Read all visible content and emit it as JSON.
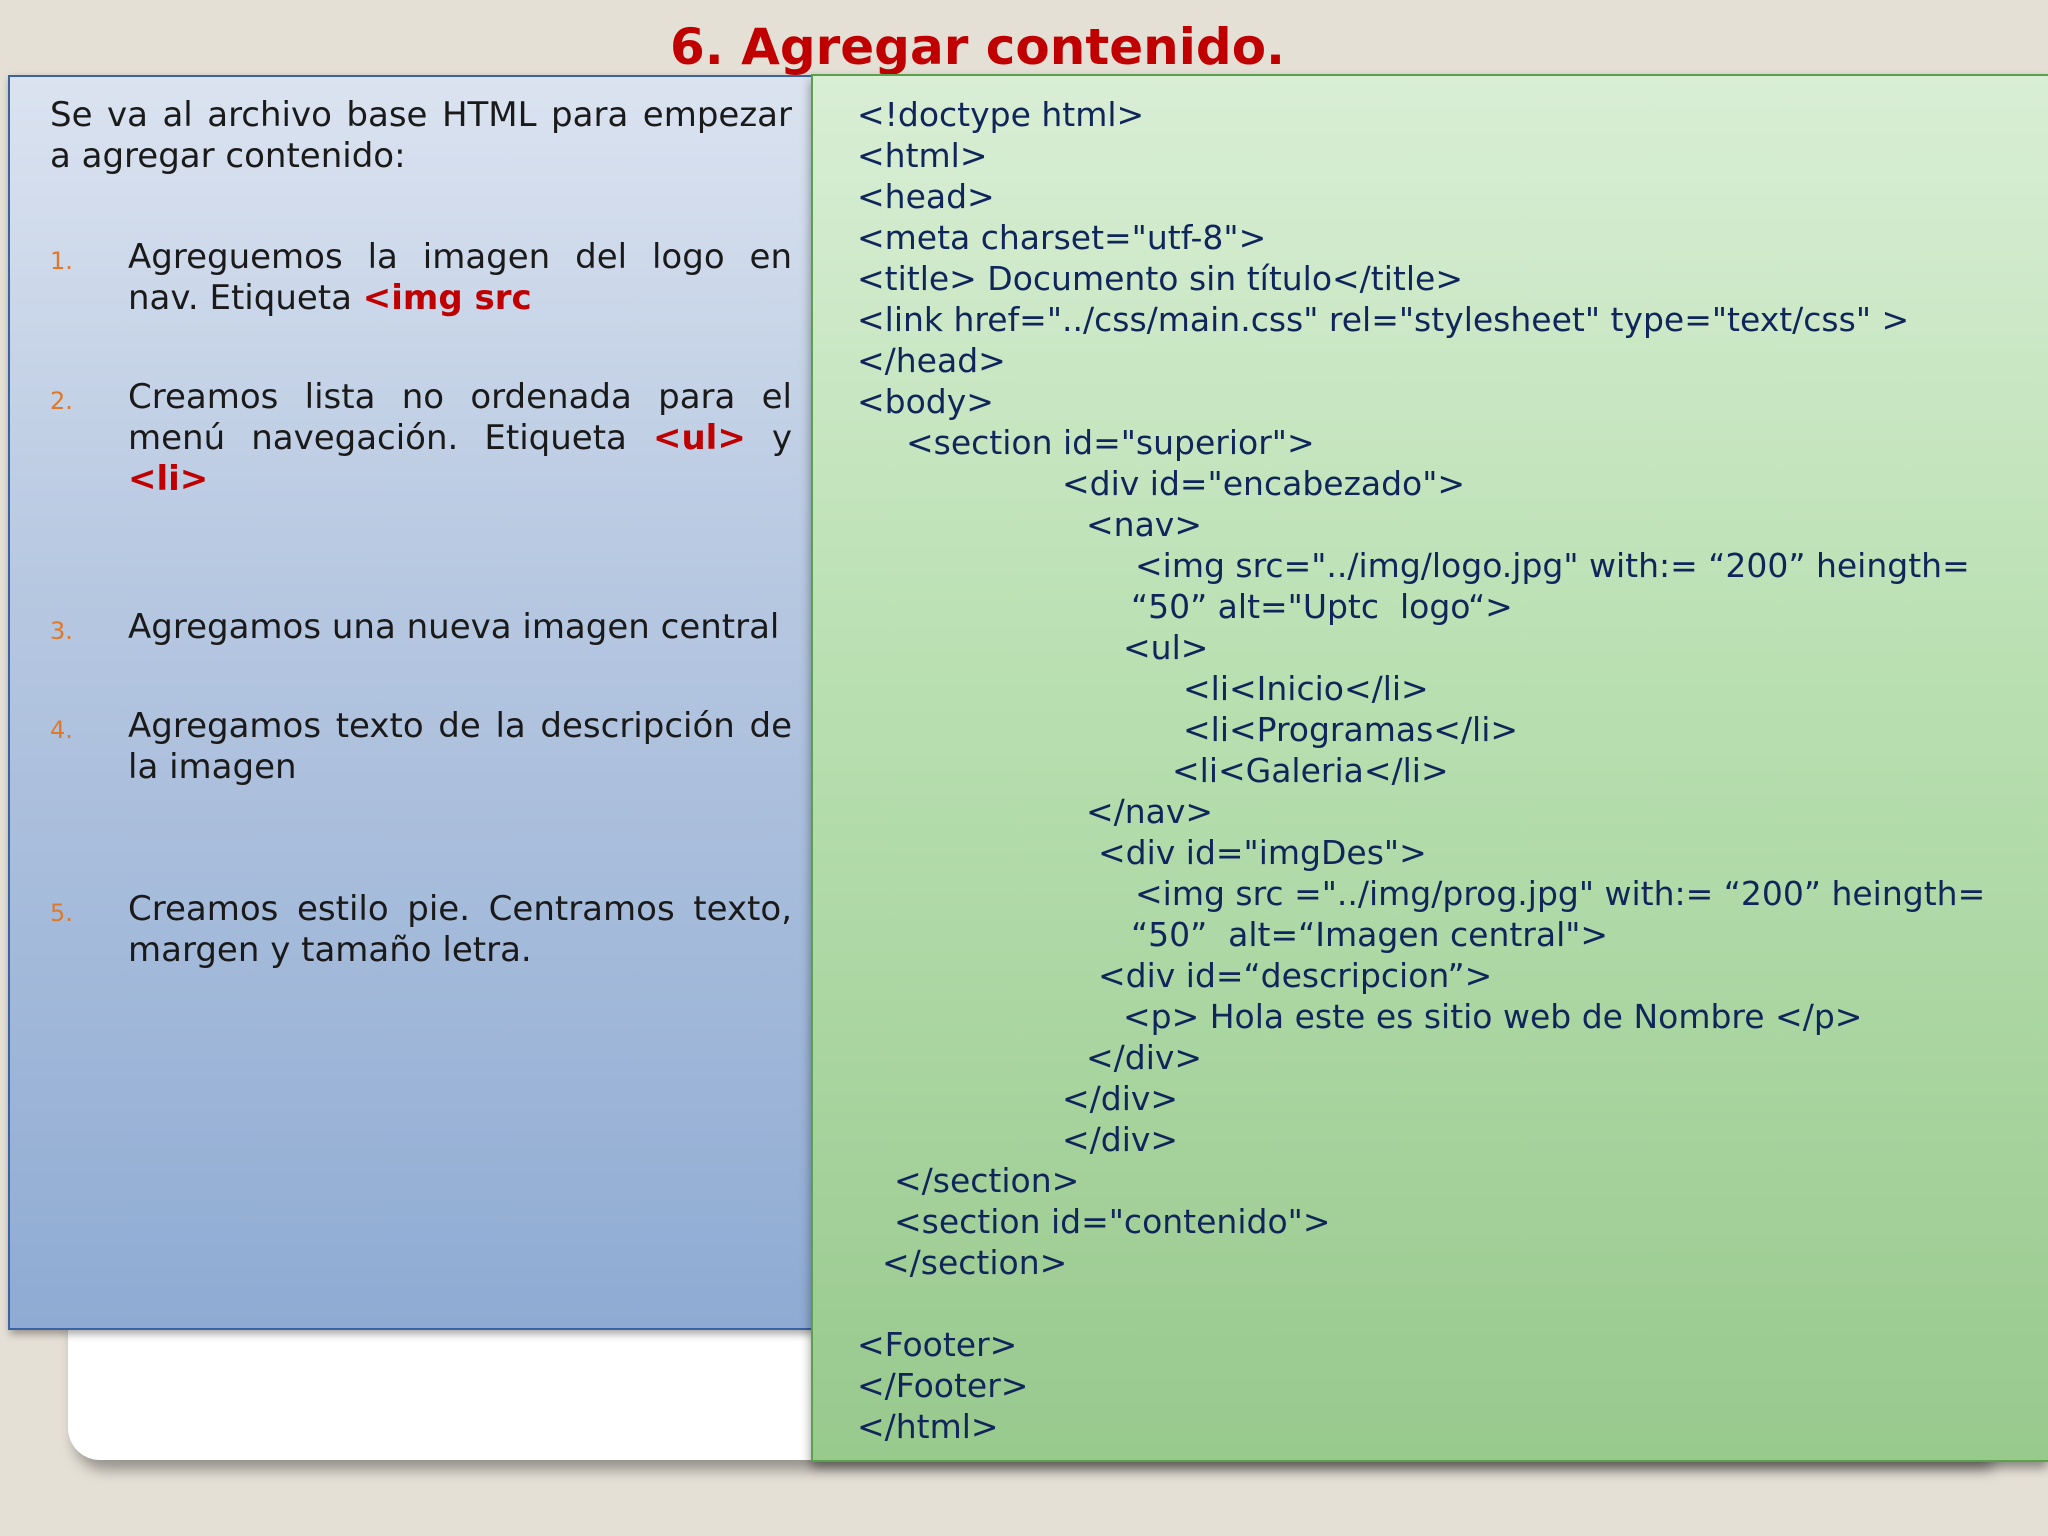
{
  "slide": {
    "title": "6. Agregar contenido."
  },
  "left": {
    "intro": "Se va al archivo base HTML para empezar a agregar contenido:",
    "steps": [
      {
        "number": "1.",
        "text_before": "Agreguemos la imagen del logo en nav.  Etiqueta ",
        "tag": "<img src"
      },
      {
        "number": "2.",
        "text_before": "Creamos lista no ordenada para el menú navegación.  Etiqueta ",
        "tag": "<ul>",
        "text_mid": " y ",
        "tag2": "<li>"
      },
      {
        "number": "3.",
        "text": "Agregamos una nueva imagen central"
      },
      {
        "number": "4.",
        "text": "Agregamos texto de la descripción de la imagen"
      },
      {
        "number": "5.",
        "text": " Creamos estilo pie. Centramos  texto, margen y tamaño letra."
      }
    ]
  },
  "code": {
    "lines": [
      "<!doctype html>",
      "<html>",
      "<head>",
      "<meta charset=\"utf-8\">",
      "<title> Documento sin título</title>",
      "<link href=\"../css/main.css\" rel=\"stylesheet\" type=\"text/css\" >",
      "</head>",
      "<body>",
      "<section id=\"superior\">",
      "<div id=\"encabezado\">",
      "<nav>",
      "<img src=\"../img/logo.jpg\" with:= “200” heingth=",
      "“50” alt=\"Uptc  logo“>",
      "<ul>",
      "<li<Inicio</li>",
      "<li<Programas</li>",
      "<li<Galeria</li>",
      "</nav>",
      "<div id=\"imgDes\">",
      "<img src =\"../img/prog.jpg\" with:= “200” heingth=",
      "“50”  alt=“Imagen central\">",
      "<div id=“descripcion”>",
      "<p> Hola este es sitio web de Nombre </p>",
      "</div>",
      "</div>",
      "</div>",
      "</section>",
      "<section id=\"contenido\">",
      "</section>",
      "",
      "<Footer>",
      "</Footer>",
      "</html>"
    ]
  },
  "colors": {
    "title": "#c00000",
    "tag": "#c00000",
    "step_number": "#e0782a",
    "code_text": "#10265a"
  }
}
